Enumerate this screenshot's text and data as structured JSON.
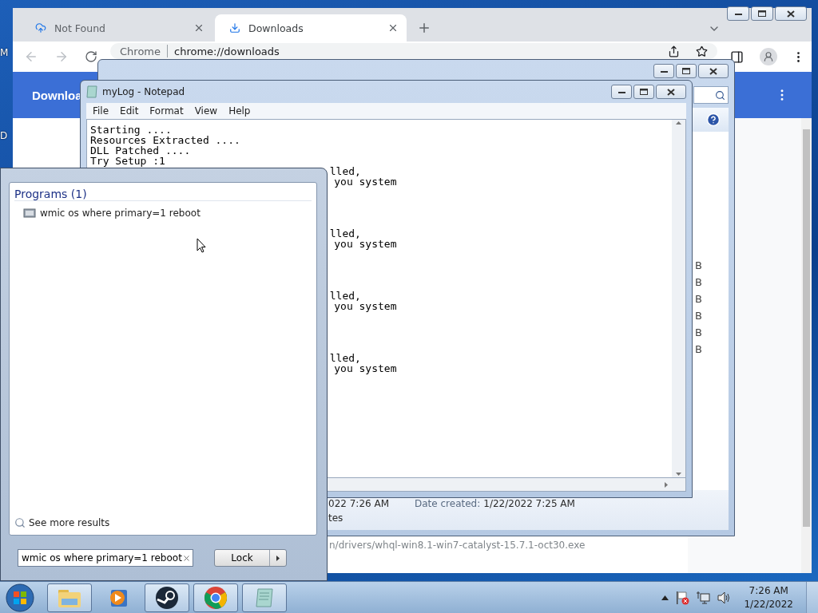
{
  "desktop": {
    "icon_labels": [
      "M",
      "D"
    ]
  },
  "browser": {
    "tabs": [
      {
        "title": "Not Found",
        "selected": false,
        "kind": "cloud"
      },
      {
        "title": "Downloads",
        "selected": true,
        "kind": "download"
      }
    ],
    "address": {
      "site": "Chrome",
      "url": "chrome://downloads"
    },
    "header_title": "Downloa",
    "download_url": "n/drivers/whql-win8.1-win7-catalyst-15.7.1-oct30.exe"
  },
  "explorer": {
    "size_fragments": [
      "B",
      "B",
      "B",
      "B",
      "B",
      "B"
    ],
    "details": {
      "modified": "022 7:26 AM",
      "created_label": "Date created:",
      "created": "1/22/2022 7:25 AM",
      "size": "tes"
    }
  },
  "notepad": {
    "title": "myLog - Notepad",
    "menu": [
      "File",
      "Edit",
      "Format",
      "View",
      "Help"
    ],
    "lines": [
      "Starting ....",
      "Resources Extracted ....",
      "DLL Patched ....",
      "Try Setup :1"
    ],
    "fragments": [
      {
        "first": "lled,",
        "second": "you system"
      },
      {
        "first": "lled,",
        "second": "you system"
      },
      {
        "first": "lled,",
        "second": "you system"
      },
      {
        "first": "lled,",
        "second": "you system"
      }
    ]
  },
  "start_menu": {
    "section": "Programs (1)",
    "results": [
      "wmic os where primary=1 reboot"
    ],
    "see_more": "See more results",
    "search_value": "wmic os where primary=1 reboot",
    "power_button": "Lock"
  },
  "taskbar": {
    "apps": [
      {
        "kind": "explorer",
        "running": true
      },
      {
        "kind": "media",
        "running": false
      },
      {
        "kind": "steam",
        "running": true
      },
      {
        "kind": "chrome",
        "running": true
      },
      {
        "kind": "notepad",
        "running": true
      }
    ],
    "clock": {
      "time": "7:26 AM",
      "date": "1/22/2022"
    }
  }
}
